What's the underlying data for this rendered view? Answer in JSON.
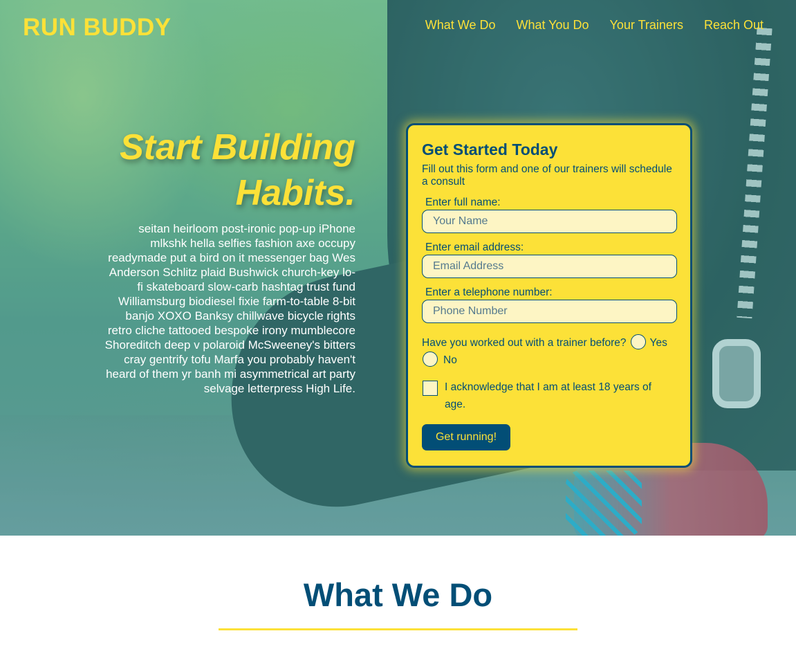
{
  "brand": {
    "logo": "RUN BUDDY",
    "accent": "#fce138",
    "primary": "#024e76"
  },
  "nav": {
    "items": [
      {
        "label": "What We Do"
      },
      {
        "label": "What You Do"
      },
      {
        "label": "Your Trainers"
      },
      {
        "label": "Reach Out"
      }
    ]
  },
  "hero": {
    "title_line1": "Start Building",
    "title_line2": "Habits.",
    "body": "seitan heirloom post-ironic pop-up iPhone mlkshk hella selfies fashion axe occupy readymade put a bird on it messenger bag Wes Anderson Schlitz plaid Bushwick church-key lo-fi skateboard slow-carb hashtag trust fund Williamsburg biodiesel fixie farm-to-table 8-bit banjo XOXO Banksy chillwave bicycle rights retro cliche tattooed bespoke irony mumblecore Shoreditch deep v polaroid McSweeney's bitters cray gentrify tofu Marfa you probably haven't heard of them yr banh mi asymmetrical art party selvage letterpress High Life."
  },
  "form": {
    "title": "Get Started Today",
    "subtitle": "Fill out this form and one of our trainers will schedule a consult",
    "name_label": "Enter full name:",
    "name_placeholder": "Your Name",
    "email_label": "Enter email address:",
    "email_placeholder": "Email Address",
    "phone_label": "Enter a telephone number:",
    "phone_placeholder": "Phone Number",
    "trainer_question": "Have you worked out with a trainer before?",
    "option_yes": "Yes",
    "option_no": "No",
    "age_ack": "I acknowledge that I am at least 18 years of age.",
    "submit_label": "Get running!"
  },
  "section": {
    "title": "What We Do"
  }
}
